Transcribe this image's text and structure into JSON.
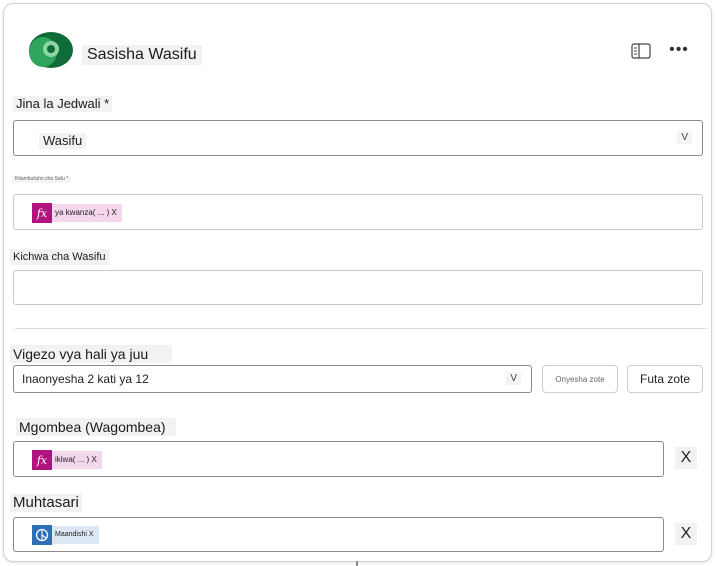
{
  "header": {
    "title": "Sasisha Wasifu"
  },
  "table_field": {
    "label": "Jina la Jedwali *",
    "value": "Wasifu",
    "chevron": "V"
  },
  "row_field": {
    "label": "Kitambulisho cha Safu *",
    "token": {
      "icon": "fx",
      "text": "ya kwanza( ... ) X"
    }
  },
  "headline_field": {
    "label": "Kichwa cha Wasifu",
    "value": ""
  },
  "advanced": {
    "label": "Vigezo vya hali ya juu",
    "select_value": "Inaonyesha 2 kati ya 12",
    "chevron": "V",
    "show_all": "Onyesha zote",
    "clear_all": "Futa zote"
  },
  "candidate_field": {
    "label": "Mgombea (Wagombea)",
    "token": {
      "icon": "fx",
      "text": "ikiwa( ... ) X"
    },
    "remove": "X"
  },
  "summary_field": {
    "label": "Muhtasari",
    "token": {
      "icon": "dataverse-icon",
      "text": "Maandishi X"
    },
    "remove": "X"
  },
  "colors": {
    "fx_token": "#b1137f",
    "fx_token_bg": "#f4d7ea",
    "dv_token": "#2f6fb6",
    "dv_token_bg": "#dde7f3",
    "logo_green": "#1f8a4c"
  }
}
